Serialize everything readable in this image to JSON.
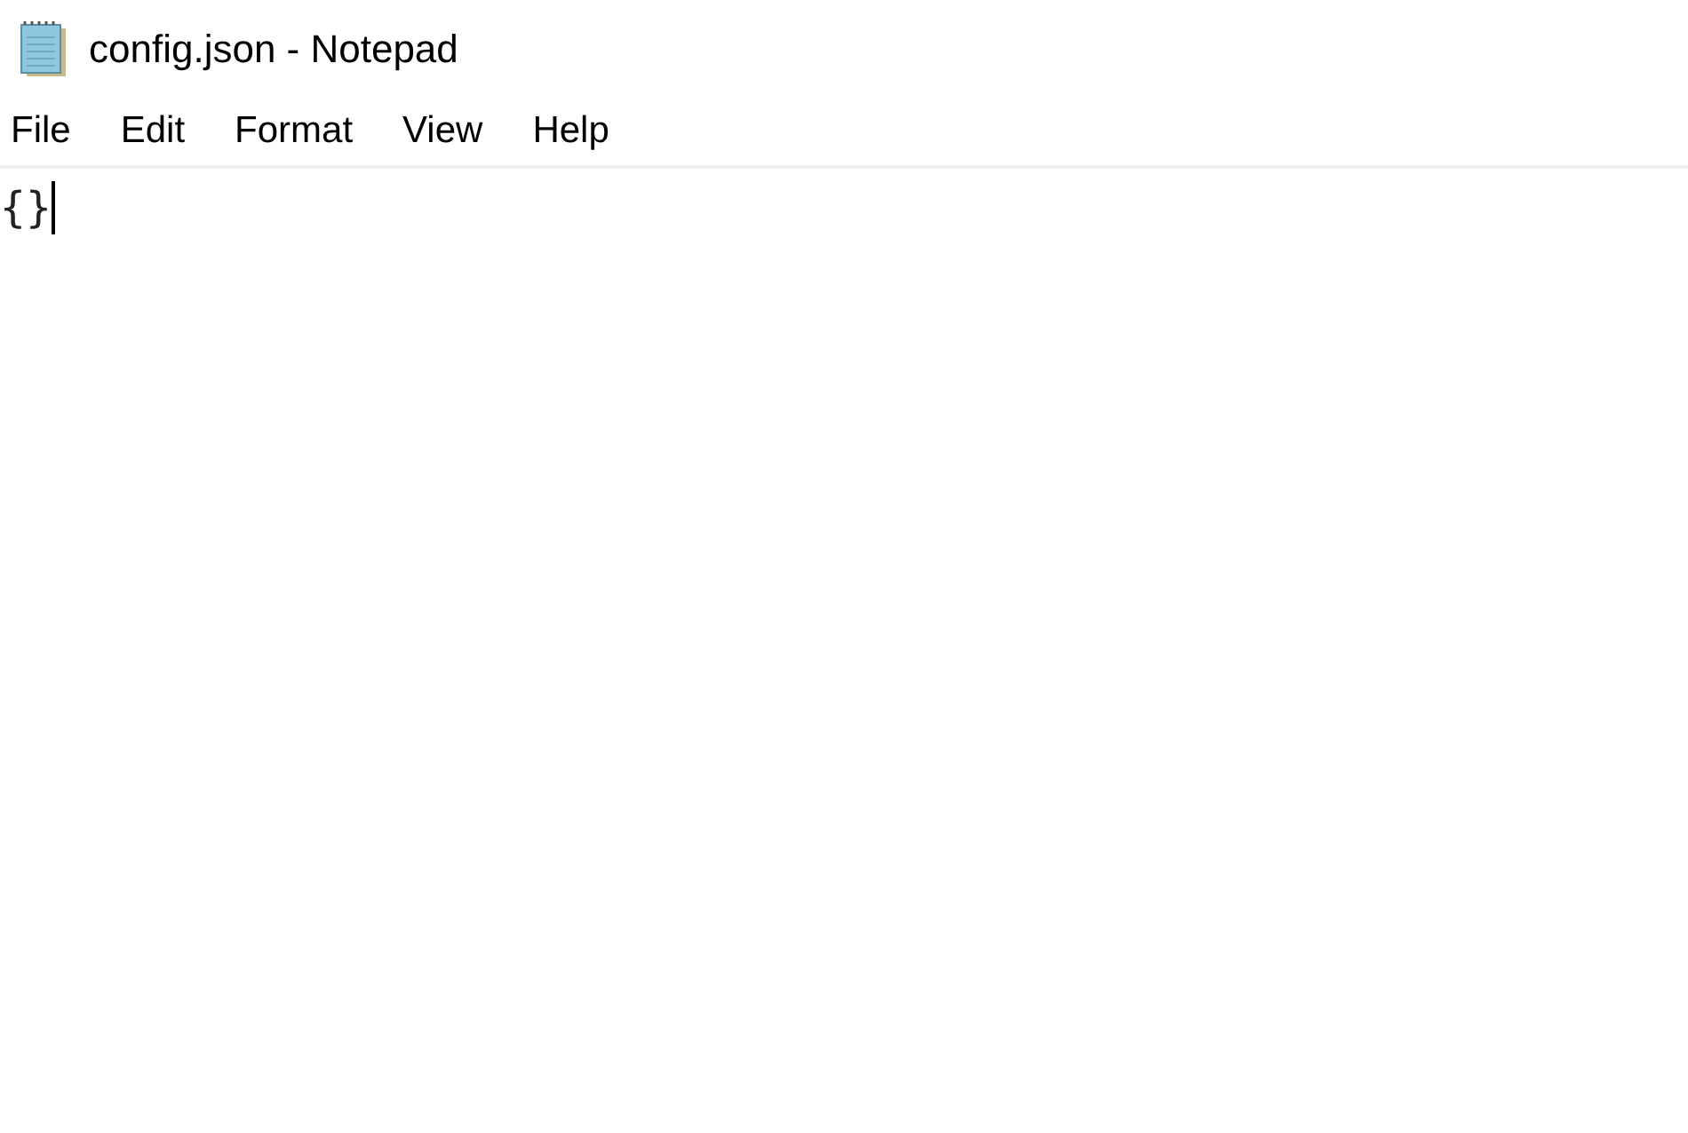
{
  "window": {
    "title": "config.json - Notepad"
  },
  "menu": [
    "File",
    "Edit",
    "Format",
    "View",
    "Help"
  ],
  "editor": {
    "text": "{}"
  }
}
